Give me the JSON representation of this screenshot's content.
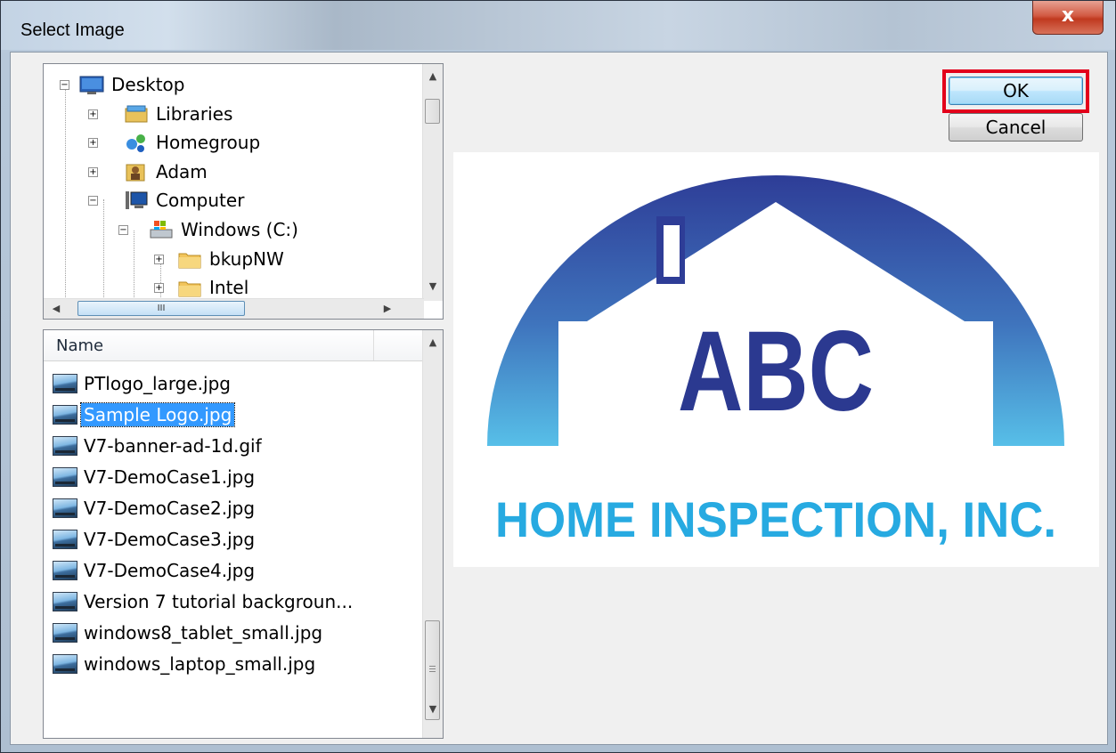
{
  "window": {
    "title": "Select Image",
    "close_glyph": "x"
  },
  "tree": {
    "nodes": [
      {
        "label": "Desktop",
        "icon": "desktop-icon",
        "expander": "−"
      },
      {
        "label": "Libraries",
        "icon": "libraries-icon",
        "expander": "+"
      },
      {
        "label": "Homegroup",
        "icon": "homegroup-icon",
        "expander": "+"
      },
      {
        "label": "Adam",
        "icon": "user-folder-icon",
        "expander": "+"
      },
      {
        "label": "Computer",
        "icon": "computer-icon",
        "expander": "−"
      },
      {
        "label": "Windows (C:)",
        "icon": "drive-icon",
        "expander": "−"
      },
      {
        "label": "bkupNW",
        "icon": "folder-icon",
        "expander": "+"
      },
      {
        "label": "Intel",
        "icon": "folder-icon",
        "expander": "+"
      }
    ],
    "hscroll_grip": "III"
  },
  "file_list": {
    "column_name": "Name",
    "files": [
      {
        "name": "PTlogo_large.jpg",
        "selected": false
      },
      {
        "name": "Sample Logo.jpg",
        "selected": true
      },
      {
        "name": "V7-banner-ad-1d.gif",
        "selected": false
      },
      {
        "name": "V7-DemoCase1.jpg",
        "selected": false
      },
      {
        "name": "V7-DemoCase2.jpg",
        "selected": false
      },
      {
        "name": "V7-DemoCase3.jpg",
        "selected": false
      },
      {
        "name": "V7-DemoCase4.jpg",
        "selected": false
      },
      {
        "name": "Version 7 tutorial backgroun...",
        "selected": false
      },
      {
        "name": "windows8_tablet_small.jpg",
        "selected": false
      },
      {
        "name": "windows_laptop_small.jpg",
        "selected": false
      }
    ]
  },
  "buttons": {
    "ok": "OK",
    "cancel": "Cancel"
  },
  "preview": {
    "logo_main": "ABC",
    "logo_sub": "HOME INSPECTION, INC.",
    "colors": {
      "dark_blue": "#2b3990",
      "light_blue": "#27aae1"
    }
  },
  "colors": {
    "highlight_border": "#e3001b",
    "selection": "#3399ff"
  }
}
